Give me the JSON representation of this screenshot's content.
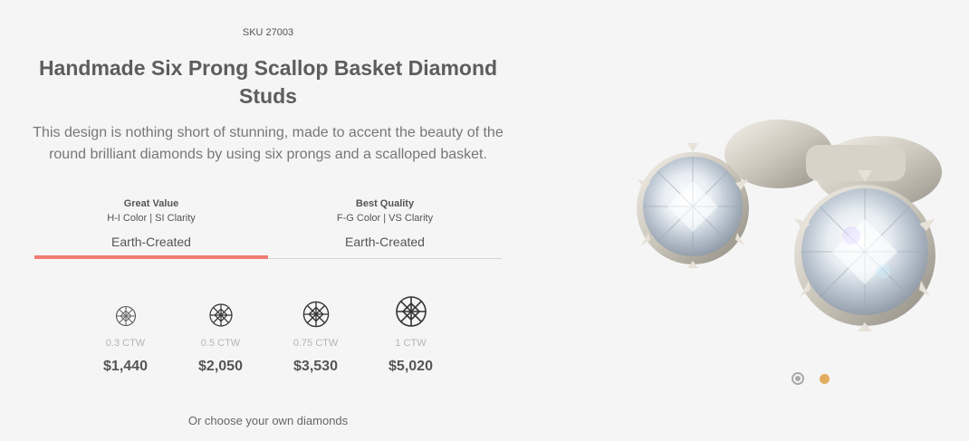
{
  "product": {
    "sku": "SKU 27003",
    "title": "Handmade Six Prong Scallop Basket Diamond Studs",
    "description": "This design is nothing short of stunning, made to accent the beauty of the round brilliant diamonds by using six prongs and a scalloped basket."
  },
  "tabs": [
    {
      "name": "Great Value",
      "spec": "H-I Color | SI Clarity",
      "label": "Earth-Created",
      "active": true
    },
    {
      "name": "Best Quality",
      "spec": "F-G Color | VS Clarity",
      "label": "Earth-Created",
      "active": false
    }
  ],
  "sizes": [
    {
      "ctw": "0.3 CTW",
      "price": "$1,440"
    },
    {
      "ctw": "0.5 CTW",
      "price": "$2,050"
    },
    {
      "ctw": "0.75 CTW",
      "price": "$3,530"
    },
    {
      "ctw": "1 CTW",
      "price": "$5,020"
    }
  ],
  "choose_own": "Or choose your own diamonds",
  "gallery": {
    "current": 1,
    "total": 2,
    "active_color": "#aaaaaa",
    "inactive_color": "#e2ad60"
  },
  "icons": {
    "diamond": "diamond-icon"
  },
  "colors": {
    "accent": "#f07c74"
  }
}
